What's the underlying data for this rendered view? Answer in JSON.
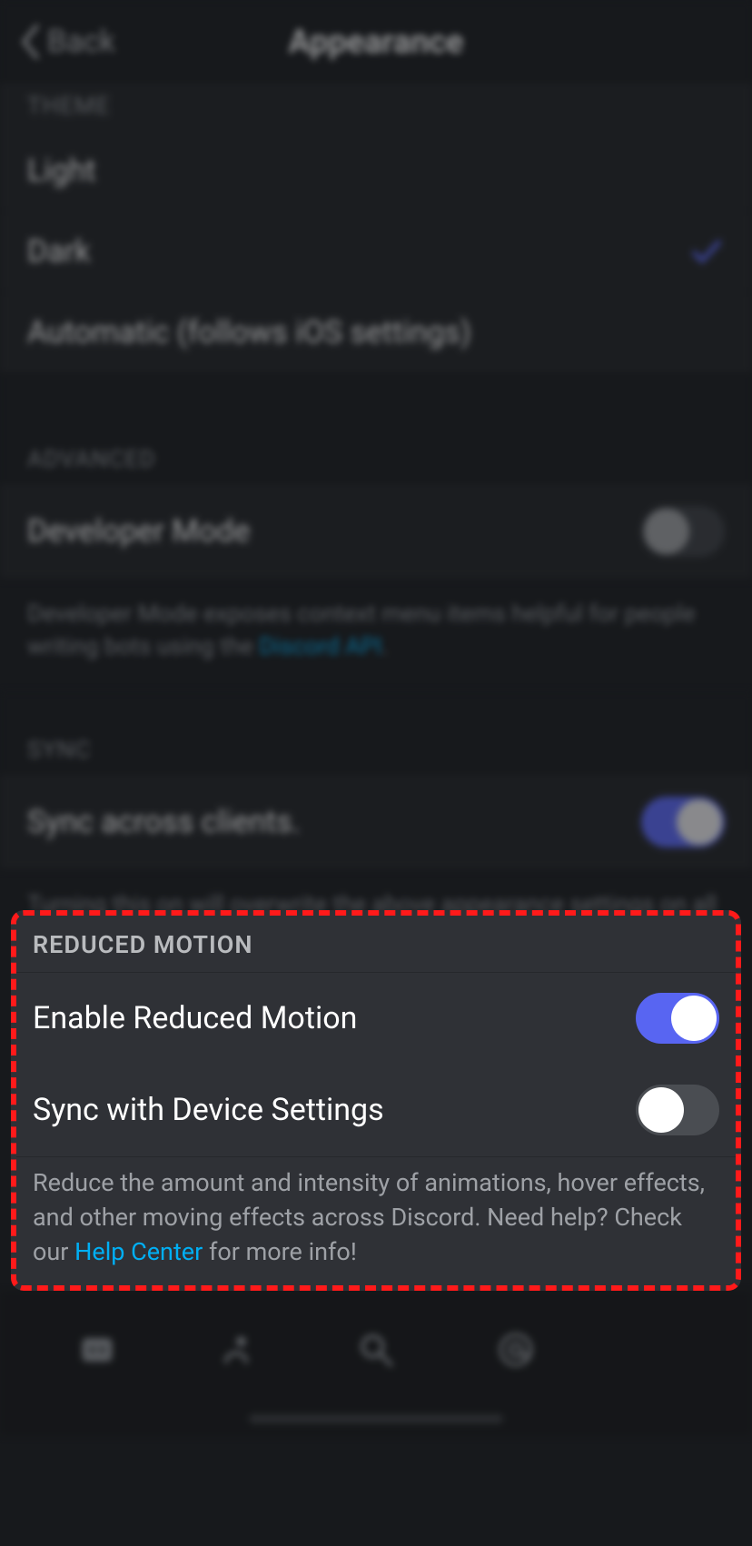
{
  "header": {
    "back_label": "Back",
    "title": "Appearance"
  },
  "theme": {
    "section": "THEME",
    "options": [
      "Light",
      "Dark",
      "Automatic (follows iOS settings)"
    ],
    "selected_index": 1
  },
  "advanced": {
    "section": "ADVANCED",
    "dev_mode_label": "Developer Mode",
    "dev_mode_on": false,
    "desc_pre": "Developer Mode exposes context menu items helpful for people writing bots using the ",
    "desc_link": "Discord API",
    "desc_post": "."
  },
  "sync": {
    "section": "SYNC",
    "label": "Sync across clients.",
    "on": true,
    "desc": "Turning this on will overwrite the above appearance settings on all other clients including desktop and browser."
  },
  "reduced_motion": {
    "section": "REDUCED MOTION",
    "enable_label": "Enable Reduced Motion",
    "enable_on": true,
    "sync_label": "Sync with Device Settings",
    "sync_on": false,
    "desc_pre": "Reduce the amount and intensity of animations, hover effects, and other moving effects across Discord. Need help? Check our ",
    "desc_link": "Help Center",
    "desc_post": " for more info!"
  }
}
